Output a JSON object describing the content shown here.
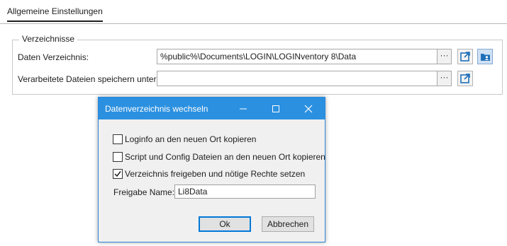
{
  "tab": {
    "label": "Allgemeine Einstellungen"
  },
  "group": {
    "title": "Verzeichnisse"
  },
  "rows": [
    {
      "label": "Daten Verzeichnis:",
      "value": "%public%\\Documents\\LOGIN\\LOGINventory 8\\Data"
    },
    {
      "label": "Verarbeitete Dateien speichern unter:",
      "value": ""
    }
  ],
  "browse_label": "···",
  "icons": {
    "open": "open-external-icon",
    "folder": "folder-user-icon"
  },
  "dialog": {
    "title": "Datenverzeichnis wechseln",
    "checkboxes": [
      {
        "label": "Loginfo an den neuen Ort kopieren",
        "checked": false
      },
      {
        "label": "Script und Config Dateien an den neuen Ort kopieren",
        "checked": false
      },
      {
        "label": "Verzeichnis freigeben und nötige Rechte setzen",
        "checked": true
      }
    ],
    "share_label": "Freigabe Name:",
    "share_value": "Li8Data",
    "ok_label": "Ok",
    "cancel_label": "Abbrechen"
  },
  "colors": {
    "title_bar": "#2b90e0",
    "accent_icon": "#1f6fb8"
  }
}
